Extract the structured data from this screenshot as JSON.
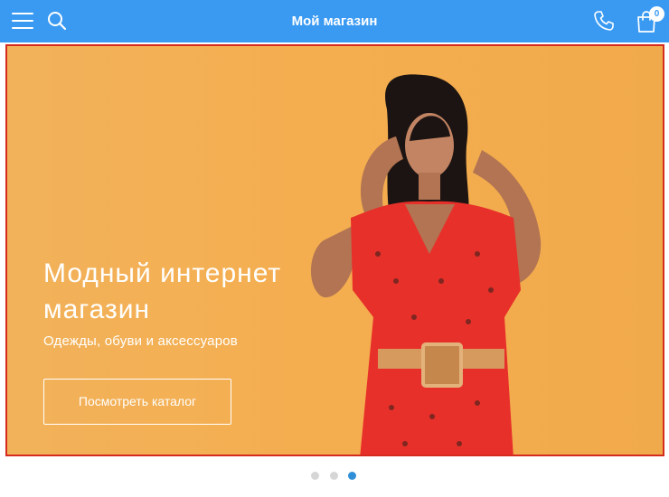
{
  "header": {
    "title": "Мой магазин",
    "cart_count": "0",
    "icons": [
      "menu-icon",
      "search-icon",
      "phone-icon",
      "cart-icon"
    ],
    "background_color": "#3a9af2"
  },
  "hero": {
    "heading": "Модный интернет магазин",
    "subtitle": "Одежды, обуви и аксессуаров",
    "button_label": "Посмотреть каталог",
    "background_color": "#f2b25a"
  },
  "slider": {
    "slide_count": 3,
    "active_index": 2,
    "active_color": "#2f8fd6",
    "inactive_color": "#d6d6d6"
  }
}
